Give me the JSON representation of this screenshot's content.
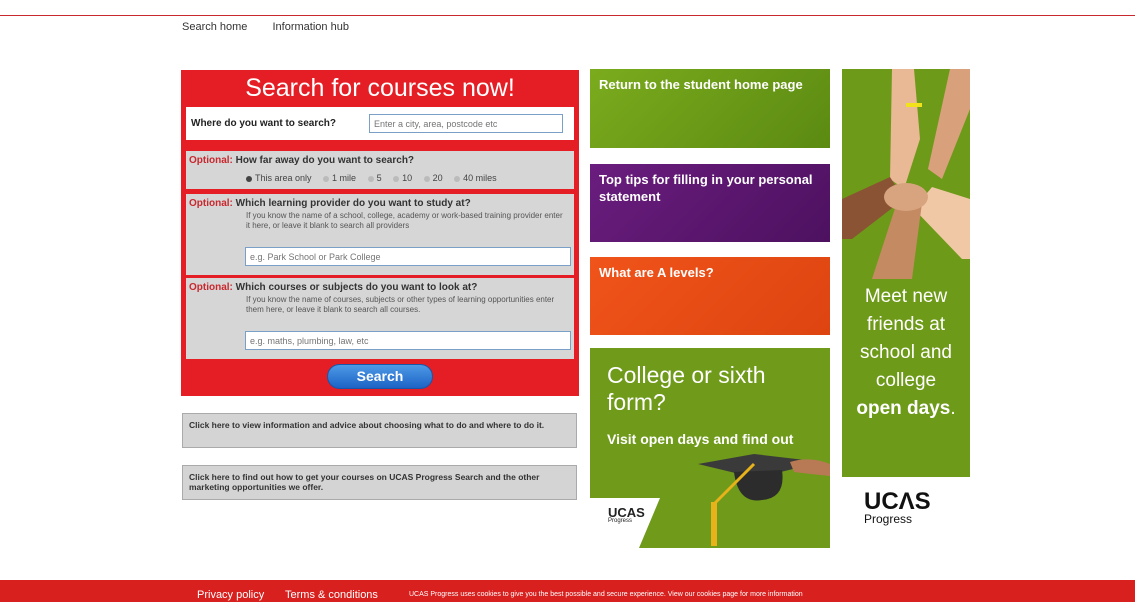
{
  "topnav": {
    "home": "Search home",
    "hub": "Information hub"
  },
  "search": {
    "title": "Search for courses now!",
    "where_label": "Where do you want to search?",
    "where_placeholder": "Enter a city, area, postcode etc",
    "optional": "Optional:",
    "distance_q": "How far away do you want to search?",
    "distance_options": [
      "This area only",
      "1 mile",
      "5",
      "10",
      "20",
      "40 miles"
    ],
    "provider_q": "Which learning provider do you want to study at?",
    "provider_help": "If you know the name of a school, college, academy or work-based training provider enter it here, or leave it blank to search all providers",
    "provider_placeholder": "e.g. Park School or Park College",
    "course_q": "Which courses or subjects do you want to look at?",
    "course_help": "If you know the name of courses, subjects or other types of learning opportunities enter them here, or leave it blank to search all courses.",
    "course_placeholder": "e.g. maths, plumbing, law, etc",
    "button": "Search"
  },
  "info": {
    "box1": "Click here to view information and advice about choosing what to do and where to do it.",
    "box2": "Click here to find out how to get your courses on UCAS Progress Search and the other marketing opportunities we offer."
  },
  "tiles": {
    "t1": "Return to the student home page",
    "t2": "Top tips for filling in your personal statement",
    "t3": "What are A levels?"
  },
  "college": {
    "big": "College or sixth form?",
    "sub": "Visit open days and find out",
    "logo": "UCAS",
    "logo_sub": "Progress"
  },
  "openday": {
    "line1": "Meet new",
    "line2": "friends at",
    "line3": "school and",
    "line4": "college",
    "bold": "open days",
    "logo": "UCΛS",
    "logo_sub": "Progress"
  },
  "footer": {
    "privacy": "Privacy policy",
    "terms": "Terms & conditions",
    "note": "UCAS Progress uses cookies to give you the best possible and secure experience. View our cookies page for more information"
  },
  "colors": {
    "brand_red": "#e51e25",
    "green": "#6f9a1a",
    "purple": "#6a1d7e",
    "orange": "#f0541a"
  }
}
